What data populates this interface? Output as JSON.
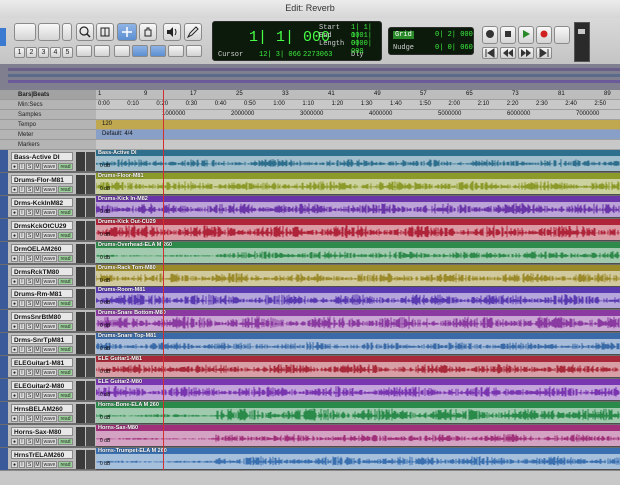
{
  "window": {
    "title": "Edit: Reverb"
  },
  "toolbar": {
    "zoom_presets": [
      "1",
      "2",
      "3",
      "4",
      "5"
    ],
    "counter": {
      "main": "1| 1| 000",
      "cursor_label": "Cursor",
      "cursor_value": "12| 3| 066",
      "sample_value": "2273063",
      "dly_label": "Dly"
    },
    "selection": {
      "start_label": "Start",
      "start_value": "1| 1| 000",
      "end_label": "End",
      "end_value": "1| 1| 000",
      "length_label": "Length",
      "length_value": "0| 0| 000"
    },
    "grid": {
      "label": "Grid",
      "value": "0| 2| 000"
    },
    "nudge": {
      "label": "Nudge",
      "value": "0| 0| 060"
    }
  },
  "ruler": {
    "labels": [
      "Bars|Beats",
      "Min:Secs",
      "Samples",
      "Tempo",
      "Meter",
      "Markers"
    ],
    "bars": [
      "1",
      "9",
      "17",
      "25",
      "33",
      "41",
      "49",
      "57",
      "65",
      "73",
      "81",
      "89"
    ],
    "minsecs": [
      "0:00",
      "0:10",
      "0:20",
      "0:30",
      "0:40",
      "0:50",
      "1:00",
      "1:10",
      "1:20",
      "1:30",
      "1:40",
      "1:50",
      "2:00",
      "2:10",
      "2:20",
      "2:30",
      "2:40",
      "2:50"
    ],
    "samples": [
      "1000000",
      "2000000",
      "3000000",
      "4000000",
      "5000000",
      "6000000",
      "7000000"
    ],
    "tempo": "120",
    "meter": "Default: 4/4"
  },
  "track_buttons": {
    "rec": "●",
    "input": "I",
    "solo": "S",
    "mute": "M",
    "view": "wave",
    "mode": "read"
  },
  "clip_gain": "0 dB",
  "tracks": [
    {
      "name": "Bass-Active DI",
      "clip": "Bass-Active DI",
      "color": "#2e6f8e"
    },
    {
      "name": "Drums-Flor-M81",
      "clip": "Drums-Floor-M81",
      "color": "#8c9a2a"
    },
    {
      "name": "Drms-KckInM82",
      "clip": "Drums-Kick In-M82",
      "color": "#6a35a8"
    },
    {
      "name": "DrmsKckOtCU29",
      "clip": "Drums-Kick Out-CU29",
      "color": "#b0243a"
    },
    {
      "name": "DrmOELAM260",
      "clip": "Drums-Overhead-ELA M 260",
      "color": "#2e8a4a"
    },
    {
      "name": "DrmsRckTM80",
      "clip": "Drums-Rack Tom-M80",
      "color": "#9a8a2a"
    },
    {
      "name": "Drums-Rm-M81",
      "clip": "Drums-Room-M81",
      "color": "#5a3ab0"
    },
    {
      "name": "DrmsSnrBtM80",
      "clip": "Drums-Snare Bottom-M80",
      "color": "#8a3aa0"
    },
    {
      "name": "Drms-SnrTpM81",
      "clip": "Drums-Snare Top-M81",
      "color": "#3a6aa8"
    },
    {
      "name": "ELEGuitar1-M81",
      "clip": "ELE Guitar1-M81",
      "color": "#a82a3a"
    },
    {
      "name": "ELEGuitar2-M80",
      "clip": "ELE Guitar2-M80",
      "color": "#7a35b0"
    },
    {
      "name": "HrnsBELAM260",
      "clip": "Horns-Bone-ELA M 260",
      "color": "#2a8a4a"
    },
    {
      "name": "Horns-Sax-M80",
      "clip": "Horns-Sax-M80",
      "color": "#a0307a"
    },
    {
      "name": "HrnsTrELAM260",
      "clip": "Horns-Trumpet-ELA M 260",
      "color": "#3a70b0"
    }
  ]
}
